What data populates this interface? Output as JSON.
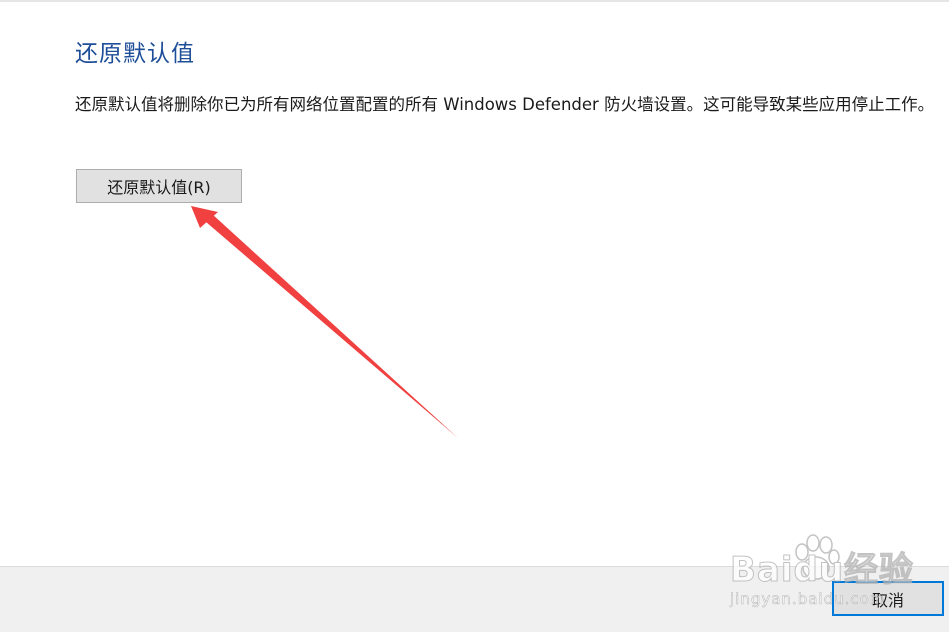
{
  "dialog": {
    "title": "还原默认值",
    "description": "还原默认值将删除你已为所有网络位置配置的所有 Windows Defender 防火墙设置。这可能导致某些应用停止工作。",
    "restore_button_label": "还原默认值(R)",
    "cancel_button_label": "取消"
  },
  "annotation": {
    "arrow_color": "#f04040"
  },
  "watermark": {
    "brand": "Baidu经验",
    "url": "jingyan.baidu.com"
  },
  "colors": {
    "title": "#1f4e99",
    "focus_border": "#0078d7",
    "footer_bg": "#f0f0f0"
  }
}
